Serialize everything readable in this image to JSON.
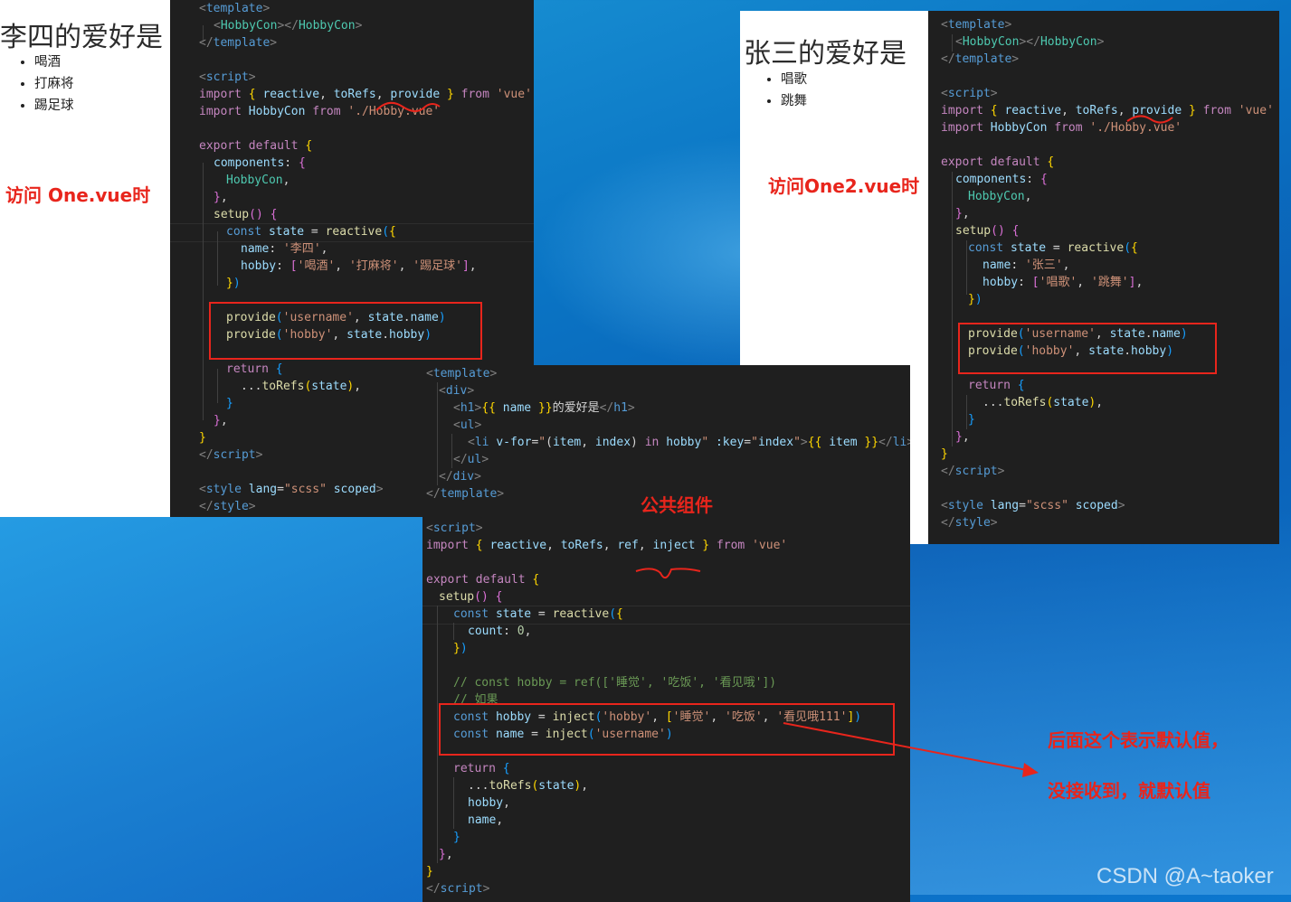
{
  "left_page": {
    "title": "李四的爱好是",
    "hobbies": [
      "喝酒",
      "打麻将",
      "踢足球"
    ],
    "note": "访问 One.vue时"
  },
  "right_page": {
    "title": "张三的爱好是",
    "hobbies": [
      "唱歌",
      "跳舞"
    ],
    "note": "访问One2.vue时"
  },
  "center_label": "公共组件",
  "annotations": {
    "line1": "后面这个表示默认值，",
    "line2": "没接收到，就默认值"
  },
  "watermark": "CSDN @A~taoker",
  "one_vue": {
    "name_value": "李四",
    "hobby_values": [
      "喝酒",
      "打麻将",
      "踢足球"
    ]
  },
  "one2_vue": {
    "name_value": "张三",
    "hobby_values": [
      "唱歌",
      "跳舞"
    ]
  },
  "common": {
    "comment1": "// const hobby = ref(['睡觉', '吃饭', '看见哦'])",
    "comment2": "// 如果",
    "default_values": [
      "睡觉",
      "吃饭",
      "看见哦111"
    ]
  },
  "colors": {
    "annotation_red": "#e8251c",
    "editor_bg": "#1f1f1f"
  }
}
